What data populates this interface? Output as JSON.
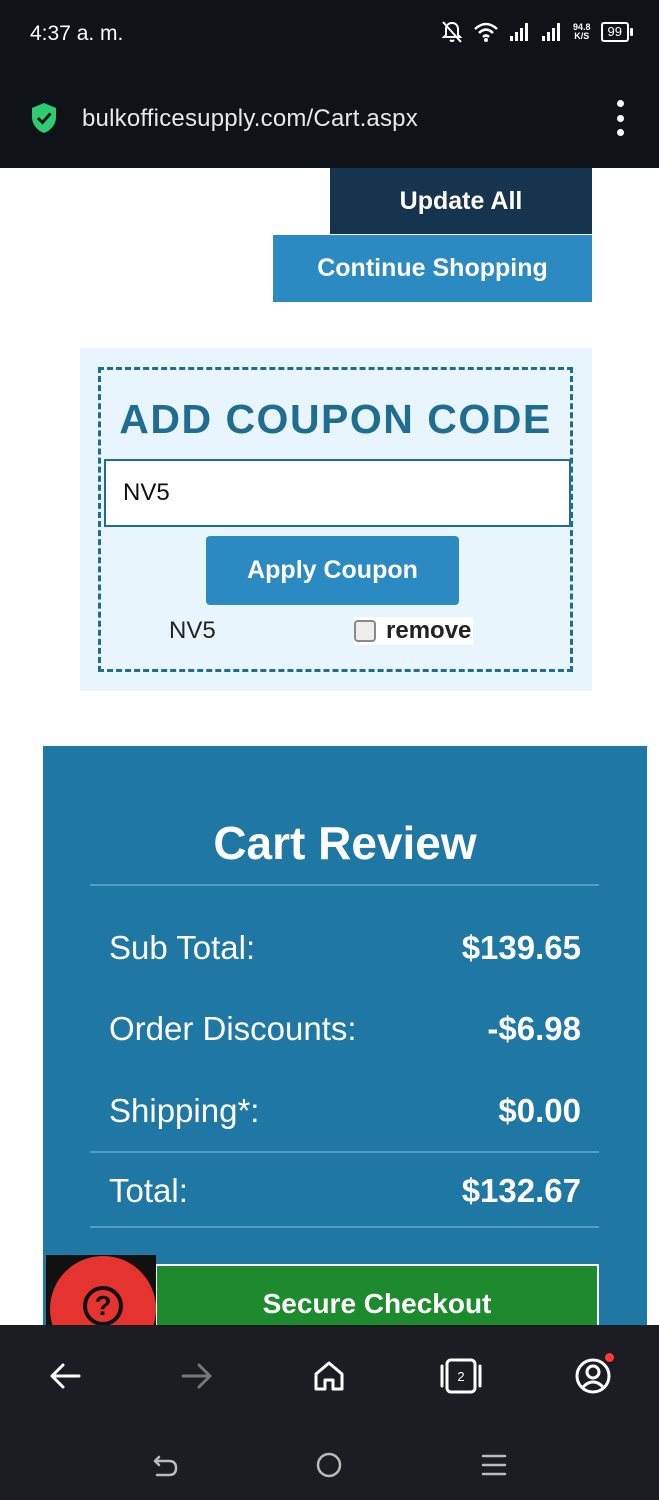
{
  "status_bar": {
    "time": "4:37 a. m.",
    "net_speed_value": "94.8",
    "net_speed_unit": "K/S",
    "battery": "99"
  },
  "browser": {
    "url": "bulkofficesupply.com/Cart.aspx",
    "tab_count": "2"
  },
  "cart_actions": {
    "update_all_label": "Update All",
    "continue_shopping_label": "Continue Shopping"
  },
  "coupon": {
    "title": "ADD COUPON CODE",
    "input_value": "NV5",
    "apply_label": "Apply Coupon",
    "applied_code": "NV5",
    "remove_label": "remove",
    "remove_checked": false
  },
  "cart_review": {
    "title": "Cart Review",
    "rows": [
      {
        "label": "Sub Total:",
        "value": "$139.65"
      },
      {
        "label": "Order Discounts:",
        "value": "-$6.98"
      },
      {
        "label": "Shipping*:",
        "value": "$0.00"
      }
    ],
    "total_label": "Total:",
    "total_value": "$132.67",
    "checkout_label": "Secure Checkout"
  },
  "colors": {
    "primary_dark": "#16344d",
    "primary_blue": "#2b8ac1",
    "cart_review_bg": "#1f77a4",
    "checkout_green": "#1d8a2e",
    "help_red": "#e5332f",
    "coupon_bg": "#e9f5fd"
  },
  "icons": {
    "shield": "shield-check-icon",
    "help": "question-circle-icon",
    "back": "arrow-left-icon",
    "forward": "arrow-right-icon",
    "home": "home-icon",
    "tabs": "tabs-icon",
    "account": "account-icon"
  }
}
